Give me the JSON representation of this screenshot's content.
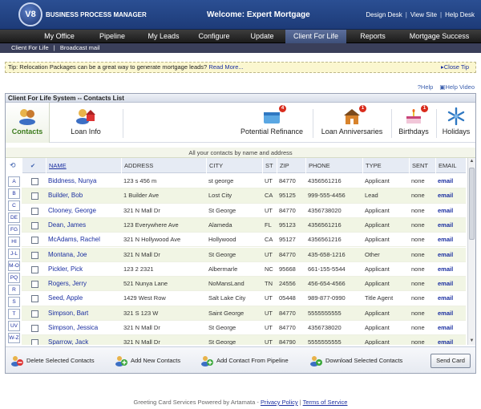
{
  "header": {
    "logo_text": "V8",
    "app_title": "BUSINESS PROCESS MANAGER",
    "welcome": "Welcome: Expert Mortgage",
    "links": [
      "Design Desk",
      "View Site",
      "Help Desk"
    ]
  },
  "main_nav": [
    {
      "label": "My Office",
      "active": false
    },
    {
      "label": "Pipeline",
      "active": false
    },
    {
      "label": "My Leads",
      "active": false
    },
    {
      "label": "Configure",
      "active": false
    },
    {
      "label": "Update",
      "active": false
    },
    {
      "label": "Client For Life",
      "active": true
    },
    {
      "label": "Reports",
      "active": false
    },
    {
      "label": "Mortgage Success",
      "active": false
    }
  ],
  "sub_nav": [
    "Client For Life",
    "|",
    "Broadcast mail"
  ],
  "tip": {
    "text": "Tip: Relocation Packages can be a great way to generate mortgage leads?",
    "link": "Read More...",
    "close": "Close Tip"
  },
  "help": {
    "help": "Help",
    "help_video": "Help Video"
  },
  "panel": {
    "title": "Client For Life System -- Contacts List",
    "subtitle": "All your contacts by name and address"
  },
  "iconbar": [
    {
      "label": "Contacts",
      "icon": "contacts-icon",
      "badge": "",
      "active": true
    },
    {
      "label": "Loan Info",
      "icon": "loan-info-icon",
      "badge": "",
      "active": false
    },
    {
      "label": "Potential Refinance",
      "icon": "refinance-icon",
      "badge": "4",
      "active": false
    },
    {
      "label": "Loan Anniversaries",
      "icon": "anniversary-icon",
      "badge": "1",
      "active": false
    },
    {
      "label": "Birthdays",
      "icon": "birthday-cake-icon",
      "badge": "1",
      "active": false
    },
    {
      "label": "Holidays",
      "icon": "snowflake-icon",
      "badge": "",
      "active": false
    }
  ],
  "alphabet": [
    "A",
    "B",
    "C",
    "DE",
    "FG",
    "HI",
    "J-L",
    "M-O",
    "PQ",
    "R",
    "S",
    "T",
    "UV",
    "W-Z"
  ],
  "columns": [
    "NAME",
    "ADDRESS",
    "CITY",
    "ST",
    "ZIP",
    "PHONE",
    "TYPE",
    "SENT",
    "EMAIL"
  ],
  "contacts": [
    {
      "name": "Biddness, Nunya",
      "address": "123 s 456 m",
      "city": "st george",
      "st": "UT",
      "zip": "84770",
      "phone": "4356561216",
      "type": "Applicant",
      "sent": "none",
      "email": "email"
    },
    {
      "name": "Builder, Bob",
      "address": "1 Builder Ave",
      "city": "Lost City",
      "st": "CA",
      "zip": "95125",
      "phone": "999-555-4456",
      "type": "Lead",
      "sent": "none",
      "email": "email"
    },
    {
      "name": "Clooney, George",
      "address": "321 N Mall Dr",
      "city": "St George",
      "st": "UT",
      "zip": "84770",
      "phone": "4356738020",
      "type": "Applicant",
      "sent": "none",
      "email": "email"
    },
    {
      "name": "Dean, James",
      "address": "123 Everywhere Ave",
      "city": "Alameda",
      "st": "FL",
      "zip": "95123",
      "phone": "4356561216",
      "type": "Applicant",
      "sent": "none",
      "email": "email"
    },
    {
      "name": "McAdams, Rachel",
      "address": "321 N Hollywood Ave",
      "city": "Hollywood",
      "st": "CA",
      "zip": "95127",
      "phone": "4356561216",
      "type": "Applicant",
      "sent": "none",
      "email": "email"
    },
    {
      "name": "Montana, Joe",
      "address": "321 N Mall Dr",
      "city": "St George",
      "st": "UT",
      "zip": "84770",
      "phone": "435-658-1216",
      "type": "Other",
      "sent": "none",
      "email": "email"
    },
    {
      "name": "Pickler, Pick",
      "address": "123 2 2321",
      "city": "Albermarle",
      "st": "NC",
      "zip": "95668",
      "phone": "661-155-5544",
      "type": "Applicant",
      "sent": "none",
      "email": "email"
    },
    {
      "name": "Rogers, Jerry",
      "address": "521 Nunya Lane",
      "city": "NoMansLand",
      "st": "TN",
      "zip": "24556",
      "phone": "456-654-4566",
      "type": "Applicant",
      "sent": "none",
      "email": "email"
    },
    {
      "name": "Seed, Apple",
      "address": "1429 West Row",
      "city": "Salt Lake City",
      "st": "UT",
      "zip": "05448",
      "phone": "989-877-0990",
      "type": "Title Agent",
      "sent": "none",
      "email": "email"
    },
    {
      "name": "Simpson, Bart",
      "address": "321 S 123 W",
      "city": "Saint George",
      "st": "UT",
      "zip": "84770",
      "phone": "5555555555",
      "type": "Applicant",
      "sent": "none",
      "email": "email"
    },
    {
      "name": "Simpson, Jessica",
      "address": "321 N Mall Dr",
      "city": "St George",
      "st": "UT",
      "zip": "84770",
      "phone": "4356738020",
      "type": "Applicant",
      "sent": "none",
      "email": "email"
    },
    {
      "name": "Sparrow, Jack",
      "address": "321 N Mall Dr",
      "city": "St George",
      "st": "UT",
      "zip": "84790",
      "phone": "5555555555",
      "type": "Applicant",
      "sent": "none",
      "email": "email"
    }
  ],
  "actions": {
    "delete": "Delete Selected Contacts",
    "add_new": "Add New Contacts",
    "add_pipeline": "Add Contact From Pipeline",
    "download": "Download Selected Contacts",
    "send_card": "Send Card"
  },
  "footer": {
    "text": "Greeting Card Services Powered by Artamata -",
    "privacy": "Privacy Policy",
    "sep": "|",
    "terms": "Terms of Service"
  }
}
